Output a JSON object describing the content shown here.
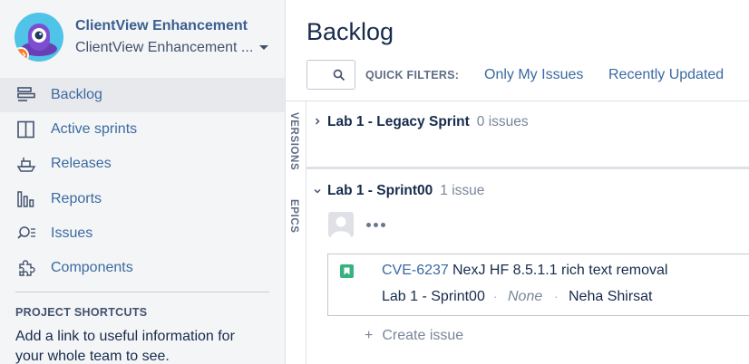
{
  "project": {
    "title": "ClientView Enhancement",
    "subtitle": "ClientView Enhancement ...",
    "colors": {
      "avatar_bg": "#4fc3e8",
      "badge": "#ff7a1a"
    }
  },
  "sidebar": {
    "items": [
      {
        "label": "Backlog",
        "icon": "backlog-icon",
        "active": true
      },
      {
        "label": "Active sprints",
        "icon": "board-icon",
        "active": false
      },
      {
        "label": "Releases",
        "icon": "ship-icon",
        "active": false
      },
      {
        "label": "Reports",
        "icon": "reports-icon",
        "active": false
      },
      {
        "label": "Issues",
        "icon": "issues-search-icon",
        "active": false
      },
      {
        "label": "Components",
        "icon": "puzzle-icon",
        "active": false
      }
    ],
    "shortcuts_heading": "PROJECT SHORTCUTS",
    "shortcuts_text": "Add a link to useful information for your whole team to see."
  },
  "main": {
    "title": "Backlog",
    "quick_filters_label": "QUICK FILTERS:",
    "filters": [
      "Only My Issues",
      "Recently Updated"
    ],
    "side_tabs": [
      "VERSIONS",
      "EPICS"
    ]
  },
  "sprints": [
    {
      "name": "Lab 1 - Legacy Sprint",
      "count": "0 issues",
      "expanded": false
    },
    {
      "name": "Lab 1 - Sprint00",
      "count": "1 issue",
      "expanded": true
    }
  ],
  "issue": {
    "key": "CVE-6237",
    "summary": "NexJ HF 8.5.1.1 rich text removal",
    "sprint": "Lab 1 - Sprint00",
    "status": "None",
    "assignee": "Neha Shirsat",
    "separator": "·",
    "type_color": "#36b37e"
  },
  "create_issue": {
    "plus": "+",
    "label": "Create issue"
  }
}
